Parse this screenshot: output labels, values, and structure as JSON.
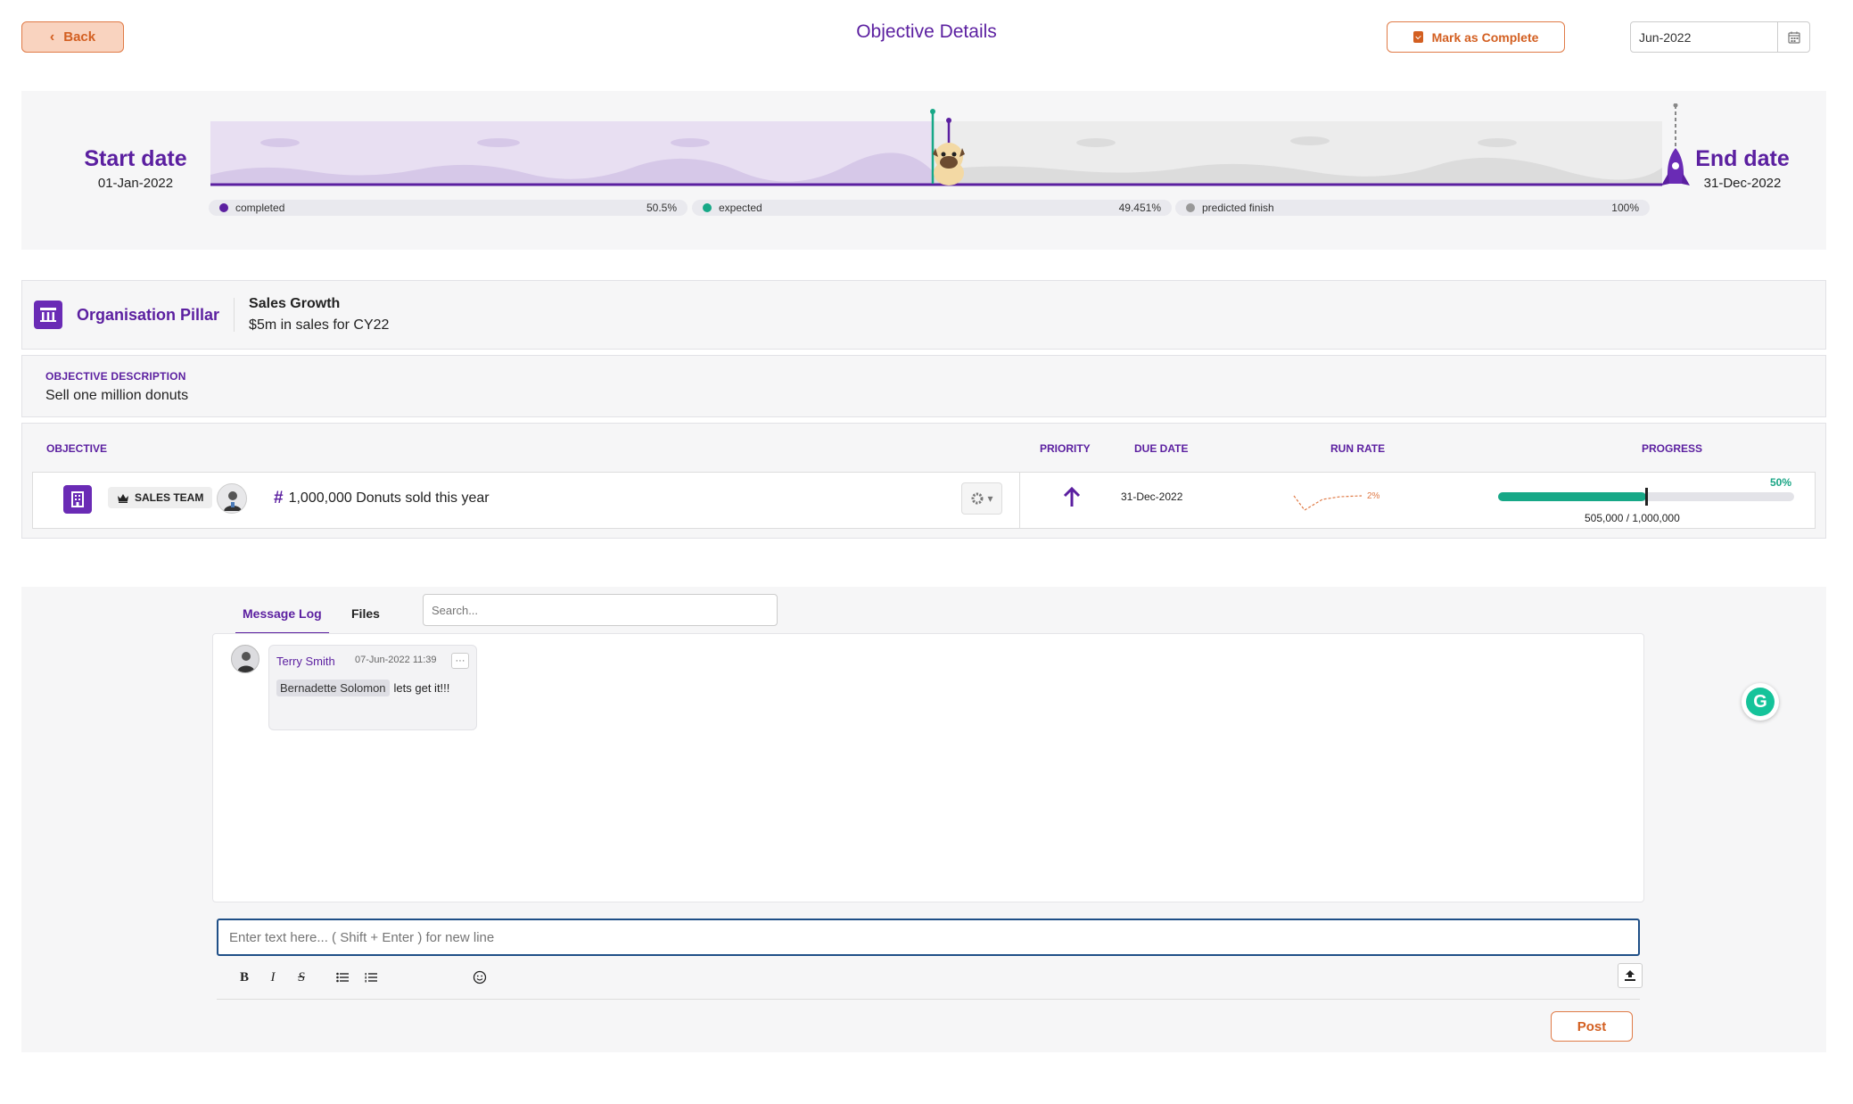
{
  "header": {
    "back_label": "Back",
    "title": "Objective Details",
    "complete_label": "Mark as Complete",
    "period_value": "Jun-2022"
  },
  "timeline": {
    "start_label": "Start date",
    "start_date": "01-Jan-2022",
    "end_label": "End date",
    "end_date": "31-Dec-2022",
    "legend": [
      {
        "label": "completed",
        "value": "50.5%",
        "color": "#5b1fa0"
      },
      {
        "label": "expected",
        "value": "49.451%",
        "color": "#17a887"
      },
      {
        "label": "predicted finish",
        "value": "100%",
        "color": "#999999"
      }
    ]
  },
  "pillar": {
    "label": "Organisation Pillar",
    "title": "Sales Growth",
    "subtitle": "$5m in sales for CY22"
  },
  "description": {
    "label": "OBJECTIVE DESCRIPTION",
    "text": "Sell one million donuts"
  },
  "objectives_table": {
    "headers": {
      "objective": "OBJECTIVE",
      "priority": "PRIORITY",
      "due_date": "DUE DATE",
      "run_rate": "RUN RATE",
      "progress": "PROGRESS"
    },
    "row": {
      "team": "SALES TEAM",
      "name": "1,000,000 Donuts sold this year",
      "due_date": "31-Dec-2022",
      "run_rate_label": "2%",
      "progress_pct_label": "50%",
      "progress_fraction": 0.5,
      "progress_counts": "505,000 / 1,000,000"
    }
  },
  "messages": {
    "tabs": [
      "Message Log",
      "Files"
    ],
    "search_placeholder": "Search...",
    "items": [
      {
        "author": "Terry Smith",
        "time": "07-Jun-2022 11:39",
        "mention": "Bernadette Solomon",
        "text": "lets get it!!!"
      }
    ],
    "compose_placeholder": "Enter text here... ( Shift + Enter ) for new line",
    "post_label": "Post"
  },
  "colors": {
    "brand_purple": "#5b1fa0",
    "accent_orange": "#d35f21",
    "progress_green": "#17a887"
  },
  "icons": [
    "chevron-left-icon",
    "clipboard-check-icon",
    "calendar-icon",
    "building-pillar-icon",
    "crown-icon",
    "hash-icon",
    "gear-icon",
    "arrow-up-icon",
    "bold-icon",
    "italic-icon",
    "strikethrough-icon",
    "bullet-list-icon",
    "numbered-list-icon",
    "emoji-icon",
    "upload-icon",
    "grammarly-icon"
  ]
}
